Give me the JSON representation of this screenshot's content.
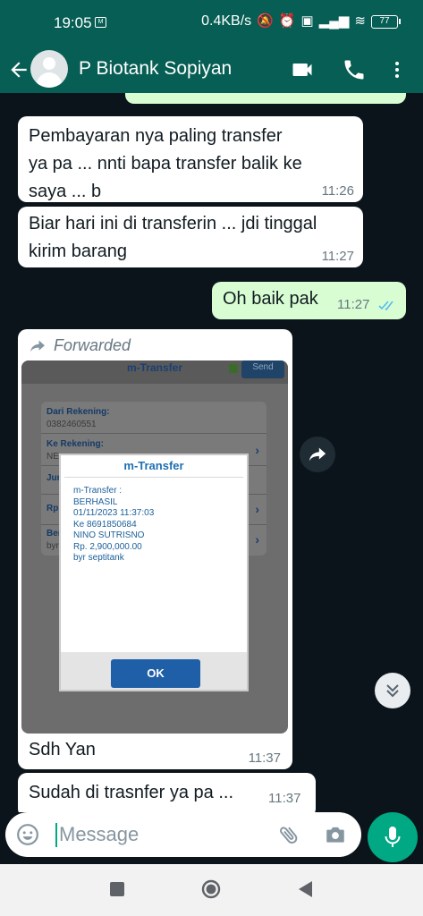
{
  "status_bar": {
    "time": "19:05",
    "app_icon_text": "M",
    "network_speed": "0.4KB/s",
    "battery": "77"
  },
  "header": {
    "contact_name": "P Biotank Sopiyan",
    "icons": [
      "back-arrow-icon",
      "video-call-icon",
      "voice-call-icon",
      "more-menu-icon"
    ]
  },
  "messages": [
    {
      "direction": "in",
      "text_lines": [
        "Pembayaran nya paling transfer",
        "ya pa ... nnti bapa transfer balik ke",
        "saya ... b"
      ],
      "time": "11:26"
    },
    {
      "direction": "in",
      "text_lines": [
        "Biar hari ini di transferin ... jdi tinggal",
        "kirim barang"
      ],
      "time": "11:27"
    },
    {
      "direction": "out",
      "text": "Oh baik pak",
      "time": "11:27",
      "status": "read"
    },
    {
      "direction": "in",
      "forwarded_label": "Forwarded",
      "image": {
        "header_title": "m-Transfer",
        "send_label": "Send",
        "form_rows": [
          {
            "label": "Dari Rekening:",
            "value": "0382460551"
          },
          {
            "label": "Ke Rekening:",
            "value": "NE"
          },
          {
            "label": "Jur",
            "value": ""
          },
          {
            "label": "Rp",
            "value": ""
          },
          {
            "label": "Ber",
            "value": "byr"
          }
        ],
        "dialog": {
          "title": "m-Transfer",
          "lines": [
            "m-Transfer :",
            "BERHASIL",
            "01/11/2023 11:37:03",
            "Ke 8691850684",
            "NINO SUTRISNO",
            "Rp. 2,900,000.00",
            "byr septitank"
          ],
          "ok_label": "OK"
        }
      },
      "caption": "Sdh Yan",
      "time": "11:37"
    },
    {
      "direction": "in",
      "text": "Sudah di trasnfer ya pa ...",
      "time": "11:37"
    }
  ],
  "composer": {
    "placeholder": "Message",
    "icons": [
      "emoji-icon",
      "attach-icon",
      "camera-icon",
      "mic-icon"
    ]
  },
  "colors": {
    "header": "#075e54",
    "chat_background": "#0b141a",
    "incoming_bubble": "#ffffff",
    "outgoing_bubble": "#d9fdd3",
    "accent": "#00a884",
    "read_ticks": "#53bdeb"
  }
}
